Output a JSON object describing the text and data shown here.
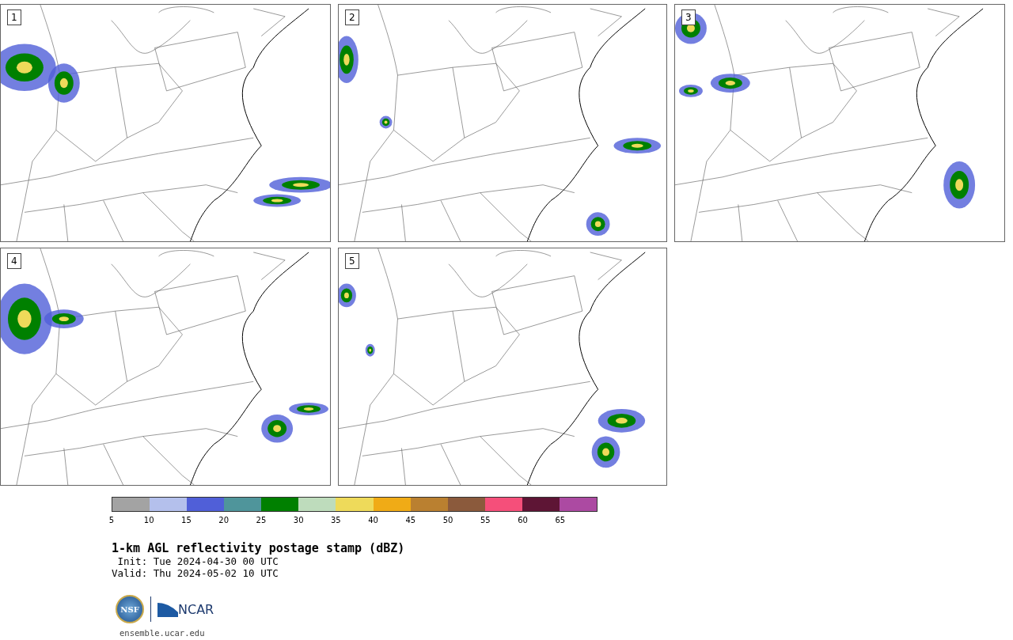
{
  "panels": [
    {
      "label": "1"
    },
    {
      "label": "2"
    },
    {
      "label": "3"
    },
    {
      "label": "4"
    },
    {
      "label": "5"
    }
  ],
  "colorbar": {
    "segments": [
      {
        "color": "#a3a3a3"
      },
      {
        "color": "#b4c0ec"
      },
      {
        "color": "#505fd8"
      },
      {
        "color": "#4f959b"
      },
      {
        "color": "#008000"
      },
      {
        "color": "#bedcbc"
      },
      {
        "color": "#eeda5a"
      },
      {
        "color": "#f0ab16"
      },
      {
        "color": "#ba8030"
      },
      {
        "color": "#8b5a3c"
      },
      {
        "color": "#f54f7a"
      },
      {
        "color": "#5e1535"
      },
      {
        "color": "#ac4aa2"
      }
    ],
    "ticks": [
      "5",
      "10",
      "15",
      "20",
      "25",
      "30",
      "35",
      "40",
      "45",
      "50",
      "55",
      "60",
      "65"
    ]
  },
  "title": "1-km AGL reflectivity postage stamp (dBZ)",
  "init": " Init: Tue 2024-04-30 00 UTC",
  "valid": "Valid: Thu 2024-05-02 10 UTC",
  "logos": {
    "nsf": "NSF",
    "ncar": "NCAR"
  },
  "url": "ensemble.ucar.edu"
}
